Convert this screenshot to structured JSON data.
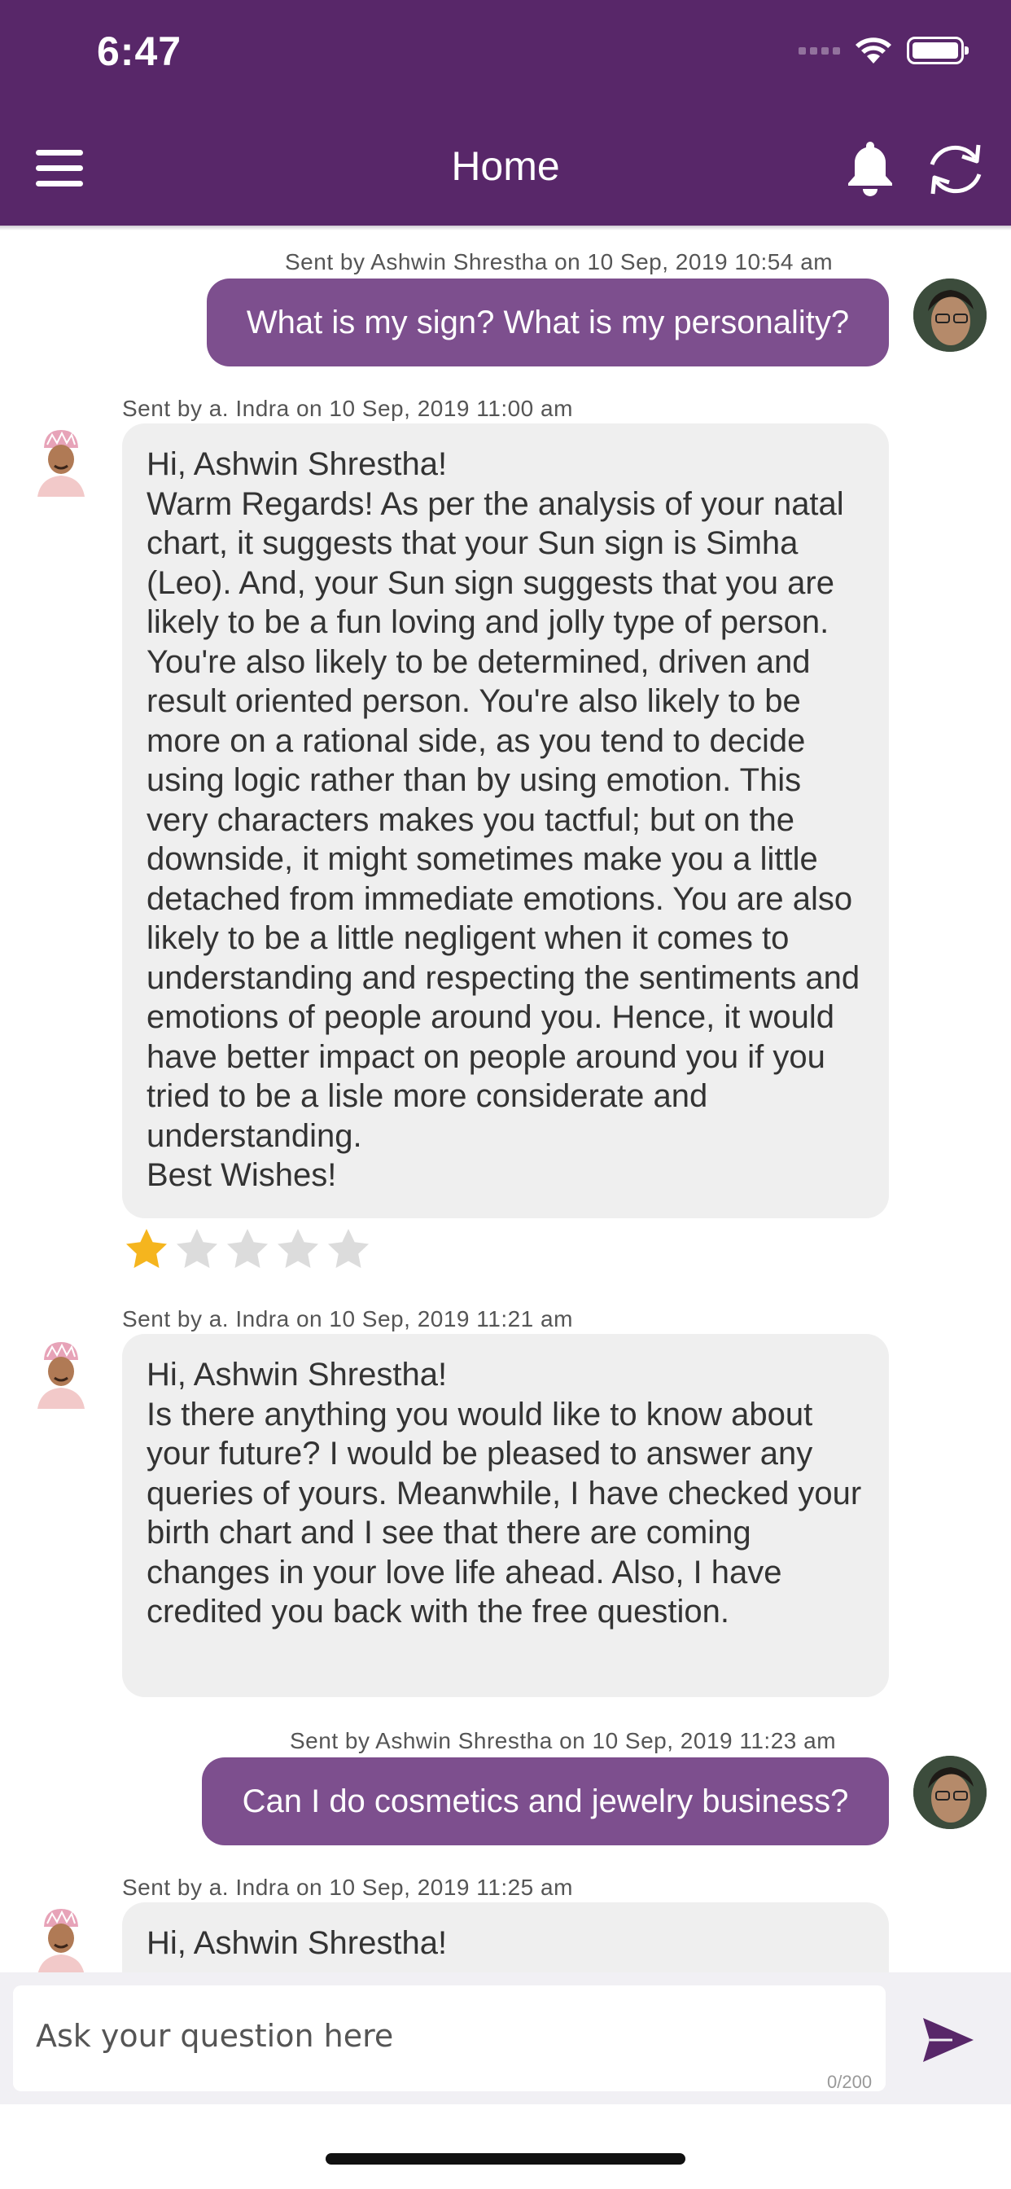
{
  "status": {
    "time": "6:47"
  },
  "nav": {
    "title": "Home"
  },
  "messages": [
    {
      "meta": "Sent by Ashwin Shrestha on 10 Sep, 2019 10:54 am",
      "text": "What is my sign? What is my personality?"
    },
    {
      "meta": "Sent by a. Indra on 10 Sep, 2019 11:00 am",
      "text": "Hi, Ashwin Shrestha!\nWarm Regards! As per the analysis of your natal chart, it suggests that your Sun sign is Simha (Leo). And, your Sun sign suggests that you are likely to be a fun loving and jolly type of person. You're also likely to be determined, driven and result oriented person. You're also likely to be more on a rational side, as you tend to decide using logic rather than by using emotion. This very characters makes you tactful; but on the downside, it might sometimes make you a little detached from immediate emotions. You are also likely to be a little negligent when it comes to understanding and respecting the sentiments and emotions of people around you. Hence, it would have better impact on people around you if you tried to be a lisle more considerate and understanding.\nBest Wishes!",
      "rating": 1,
      "rating_max": 5
    },
    {
      "meta": "Sent by a. Indra on 10 Sep, 2019 11:21 am",
      "text": "Hi, Ashwin Shrestha!\nIs there anything you would like to know about your future? I would be pleased to answer any queries of yours. Meanwhile, I have checked your birth chart and I see that there are coming changes in your love life ahead. Also, I have credited you back with the free question."
    },
    {
      "meta": "Sent by Ashwin Shrestha on 10 Sep, 2019 11:23 am",
      "text": "Can I do cosmetics and jewelry business?"
    },
    {
      "meta": "Sent by a. Indra on 10 Sep, 2019 11:25 am",
      "text": "Hi, Ashwin Shrestha!"
    }
  ],
  "composer": {
    "placeholder": "Ask your question here",
    "counter": "0/200"
  },
  "colors": {
    "brand": "#582769",
    "outgoing_bubble": "#7d4f8e",
    "incoming_bubble": "#efefef",
    "star_active": "#f5b51e"
  }
}
